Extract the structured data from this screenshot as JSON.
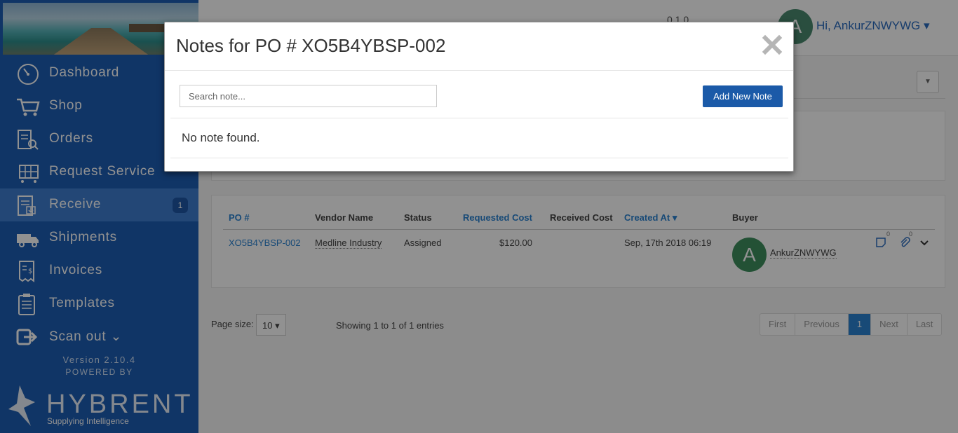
{
  "sidebar": {
    "items": [
      {
        "label": "Dashboard",
        "icon": "dashboard-gauge-icon"
      },
      {
        "label": "Shop",
        "icon": "shopping-cart-icon"
      },
      {
        "label": "Orders",
        "icon": "orders-clipboard-search-icon"
      },
      {
        "label": "Request Service",
        "icon": "request-service-cart-icon"
      },
      {
        "label": "Receive",
        "icon": "receive-clipboard-icon",
        "badge": "1",
        "active": true
      },
      {
        "label": "Shipments",
        "icon": "truck-icon"
      },
      {
        "label": "Invoices",
        "icon": "invoice-icon"
      },
      {
        "label": "Templates",
        "icon": "templates-clipboard-icon"
      },
      {
        "label": "Scan out",
        "icon": "scan-out-icon"
      }
    ],
    "version": "Version 2.10.4",
    "powered_by": "POWERED BY",
    "logo_text": "HYBRENT",
    "logo_tagline": "Supplying Intelligence"
  },
  "topbar": {
    "counts": "0  1  0",
    "avatar_letter": "A",
    "greeting": "Hi, AnkurZNWYWG"
  },
  "table": {
    "headers": {
      "po": "PO #",
      "vendor": "Vendor Name",
      "status": "Status",
      "requested_cost": "Requested Cost",
      "received_cost": "Received Cost",
      "created_at": "Created At",
      "buyer": "Buyer"
    },
    "row": {
      "po": "XO5B4YBSP-002",
      "vendor": "Medline Industry",
      "status": "Assigned",
      "requested_cost": "$120.00",
      "received_cost": "",
      "created_at": "Sep, 17th 2018 06:19",
      "buyer_initial": "A",
      "buyer": "AnkurZNWYWG",
      "notes_count": "0",
      "attachments_count": "0"
    }
  },
  "paging": {
    "page_size_label": "Page size:",
    "page_size": "10",
    "showing": "Showing 1 to 1 of 1 entries",
    "buttons": [
      "First",
      "Previous",
      "1",
      "Next",
      "Last"
    ]
  },
  "modal": {
    "title": "Notes for PO # XO5B4YBSP-002",
    "search_placeholder": "Search note...",
    "add_button": "Add New Note",
    "empty_message": "No note found."
  },
  "colors": {
    "sidebar": "#1d5db3",
    "primary_button": "#1b5aa8",
    "link": "#2b83d1"
  }
}
